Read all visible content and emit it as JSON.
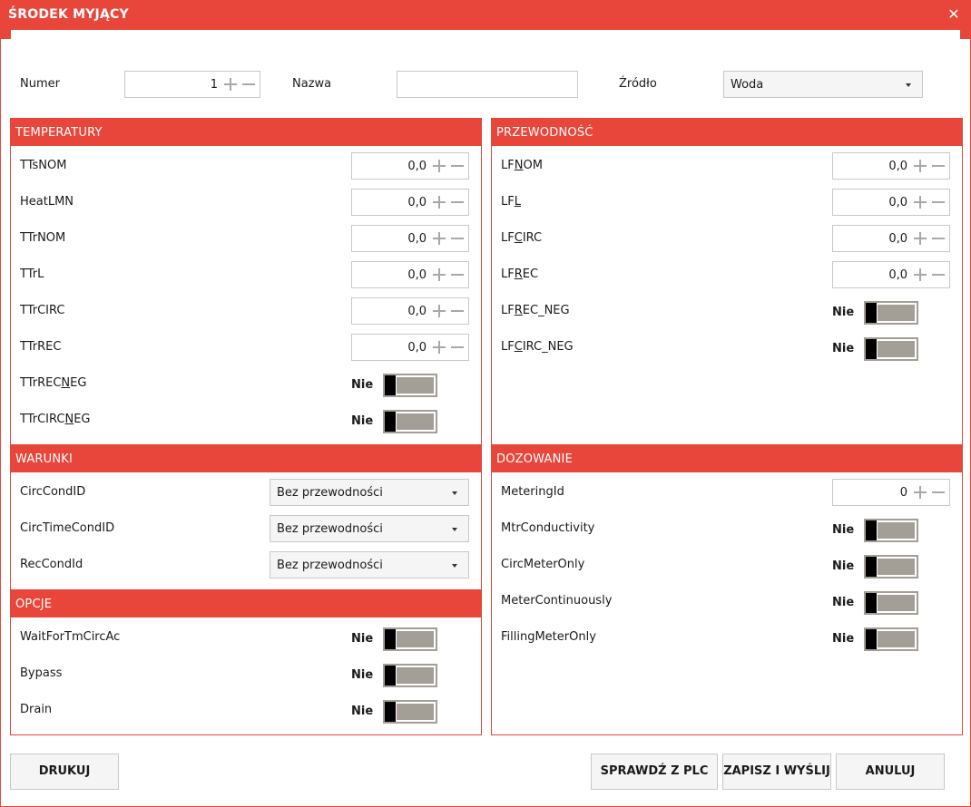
{
  "window": {
    "title": "ŚRODEK MYJĄCY"
  },
  "header": {
    "numer": {
      "label": "Numer",
      "value": "1"
    },
    "nazwa": {
      "label": "Nazwa",
      "value": ""
    },
    "zrodlo": {
      "label": "Źródło",
      "value": "Woda"
    }
  },
  "temperatury": {
    "title": "TEMPERATURY",
    "fields": [
      {
        "label": "TTsNOM",
        "value": "0,0"
      },
      {
        "label": "HeatLMN",
        "value": "0,0"
      },
      {
        "label": "TTrNOM",
        "value": "0,0"
      },
      {
        "label": "TTrL",
        "value": "0,0"
      },
      {
        "label": "TTrCIRC",
        "value": "0,0"
      },
      {
        "label": "TTrREC",
        "value": "0,0"
      }
    ],
    "toggles": [
      {
        "label_a": "TTrREC",
        "label_u": "N",
        "label_b": "EG",
        "state": "Nie"
      },
      {
        "label_a": "TTrCIRC",
        "label_u": "N",
        "label_b": "EG",
        "state": "Nie"
      }
    ]
  },
  "przewodnosc": {
    "title": "PRZEWODNOŚĆ",
    "fields": [
      {
        "label_a": "LF",
        "label_u": "N",
        "label_b": "OM",
        "value": "0,0"
      },
      {
        "label_a": "LF",
        "label_u": "L",
        "label_b": "",
        "value": "0,0"
      },
      {
        "label_a": "LF",
        "label_u": "C",
        "label_b": "IRC",
        "value": "0,0"
      },
      {
        "label_a": "LF",
        "label_u": "R",
        "label_b": "EC",
        "value": "0,0"
      }
    ],
    "toggles": [
      {
        "label_a": "LF",
        "label_u": "R",
        "label_b": "EC_NEG",
        "state": "Nie"
      },
      {
        "label_a": "LF",
        "label_u": "C",
        "label_b": "IRC_NEG",
        "state": "Nie"
      }
    ]
  },
  "warunki": {
    "title": "WARUNKI",
    "selects": [
      {
        "label": "CircCondID",
        "value": "Bez przewodności"
      },
      {
        "label": "CircTimeCondID",
        "value": "Bez przewodności"
      },
      {
        "label": "RecCondId",
        "value": "Bez przewodności"
      }
    ]
  },
  "opcje": {
    "title": "OPCJE",
    "toggles": [
      {
        "label": "WaitForTmCircAc",
        "state": "Nie"
      },
      {
        "label": "Bypass",
        "state": "Nie"
      },
      {
        "label": "Drain",
        "state": "Nie"
      }
    ]
  },
  "dozowanie": {
    "title": "DOZOWANIE",
    "metering": {
      "label": "MeteringId",
      "value": "0"
    },
    "toggles": [
      {
        "label": "MtrConductivity",
        "state": "Nie"
      },
      {
        "label": "CircMeterOnly",
        "state": "Nie"
      },
      {
        "label": "MeterContinuously",
        "state": "Nie"
      },
      {
        "label": "FillingMeterOnly",
        "state": "Nie"
      }
    ]
  },
  "buttons": {
    "print": "DRUKUJ",
    "check_plc": "SPRAWDŹ Z PLC",
    "save_send": "ZAPISZ I WYŚLIJ",
    "cancel": "ANULUJ"
  },
  "colors": {
    "accent": "#e9463b",
    "toggle_track": "#a39e96"
  }
}
